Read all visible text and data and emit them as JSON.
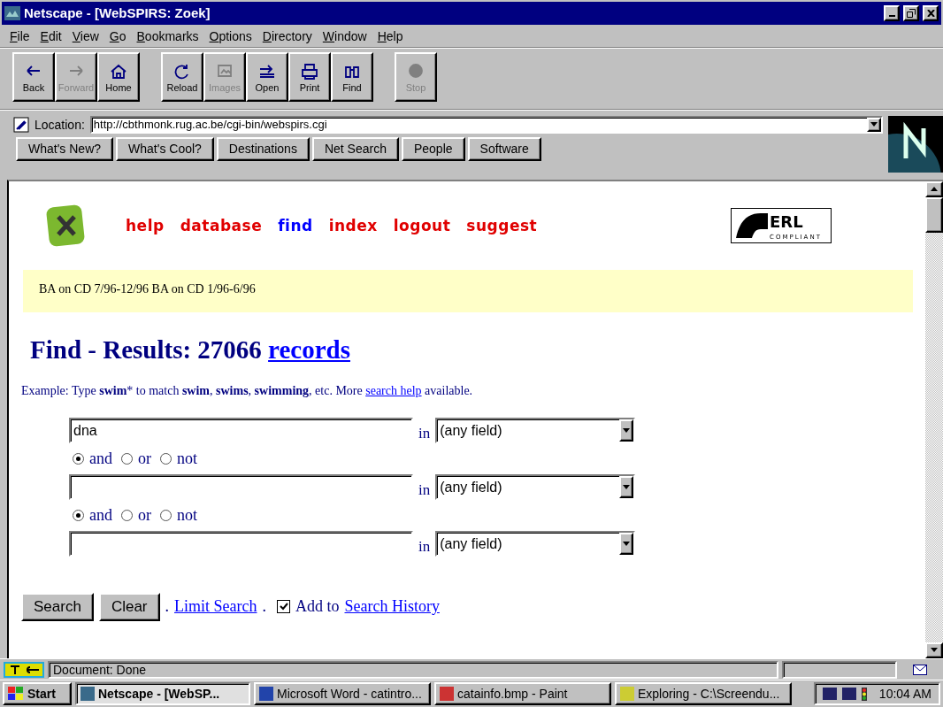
{
  "window": {
    "title": "Netscape - [WebSPIRS: Zoek]"
  },
  "menu": [
    "File",
    "Edit",
    "View",
    "Go",
    "Bookmarks",
    "Options",
    "Directory",
    "Window",
    "Help"
  ],
  "toolbar": [
    {
      "kind": "back",
      "label": "Back",
      "disabled": false
    },
    {
      "kind": "forward",
      "label": "Forward",
      "disabled": true
    },
    {
      "kind": "home",
      "label": "Home",
      "disabled": false
    },
    {
      "kind": "reload",
      "label": "Reload",
      "disabled": false,
      "gap": true
    },
    {
      "kind": "images",
      "label": "Images",
      "disabled": true
    },
    {
      "kind": "open",
      "label": "Open",
      "disabled": false
    },
    {
      "kind": "print",
      "label": "Print",
      "disabled": false
    },
    {
      "kind": "find",
      "label": "Find",
      "disabled": false
    },
    {
      "kind": "stop",
      "label": "Stop",
      "disabled": true,
      "gap": true
    }
  ],
  "location": {
    "label": "Location:",
    "value": "http://cbthmonk.rug.ac.be/cgi-bin/webspirs.cgi"
  },
  "directory_buttons": [
    "What's New?",
    "What's Cool?",
    "Destinations",
    "Net Search",
    "People",
    "Software"
  ],
  "page": {
    "nav": [
      {
        "label": "help",
        "selected": false
      },
      {
        "label": "database",
        "selected": false
      },
      {
        "label": "find",
        "selected": true
      },
      {
        "label": "index",
        "selected": false
      },
      {
        "label": "logout",
        "selected": false
      },
      {
        "label": "suggest",
        "selected": false
      }
    ],
    "databases": "BA on CD 7/96-12/96  BA on CD 1/96-6/96",
    "heading": "Find - Results: 27066",
    "heading_link": "records",
    "erl_logo": {
      "title": "ERL",
      "subtitle": "COMPLIANT"
    },
    "example": "Example: Type **swim*** to match **swim**, **swims**, **swimming**, etc. More",
    "example_link": "search help",
    "example_end": "available.",
    "rows": [
      {
        "kind": "query",
        "value": "dna",
        "in_label": "in",
        "field": "(any field)"
      },
      {
        "kind": "connector",
        "options": [
          {
            "label": "and",
            "selected": true
          },
          {
            "label": "or",
            "selected": false
          },
          {
            "label": "not",
            "selected": false
          }
        ]
      },
      {
        "kind": "query",
        "value": "",
        "in_label": "in",
        "field": "(any field)"
      },
      {
        "kind": "connector",
        "options": [
          {
            "label": "and",
            "selected": true
          },
          {
            "label": "or",
            "selected": false
          },
          {
            "label": "not",
            "selected": false
          }
        ]
      },
      {
        "kind": "query",
        "value": "",
        "in_label": "in",
        "field": "(any field)"
      }
    ],
    "buttons": [
      "Search",
      "Clear"
    ],
    "sep1": ".",
    "limit_link": "Limit Search",
    "sep2": ".",
    "history": {
      "checked": true,
      "label": "Add to",
      "link": "Search History"
    }
  },
  "status_bar": {
    "text": "Document: Done"
  },
  "taskbar": {
    "start": "Start",
    "tasks": [
      {
        "label": "Netscape - [WebSP...",
        "selected": true
      },
      {
        "label": "Microsoft Word - catintro...",
        "selected": false
      },
      {
        "label": "catainfo.bmp - Paint",
        "selected": false
      },
      {
        "label": "Exploring - C:\\Screendu...",
        "selected": false
      }
    ],
    "clock": "10:04 AM"
  }
}
